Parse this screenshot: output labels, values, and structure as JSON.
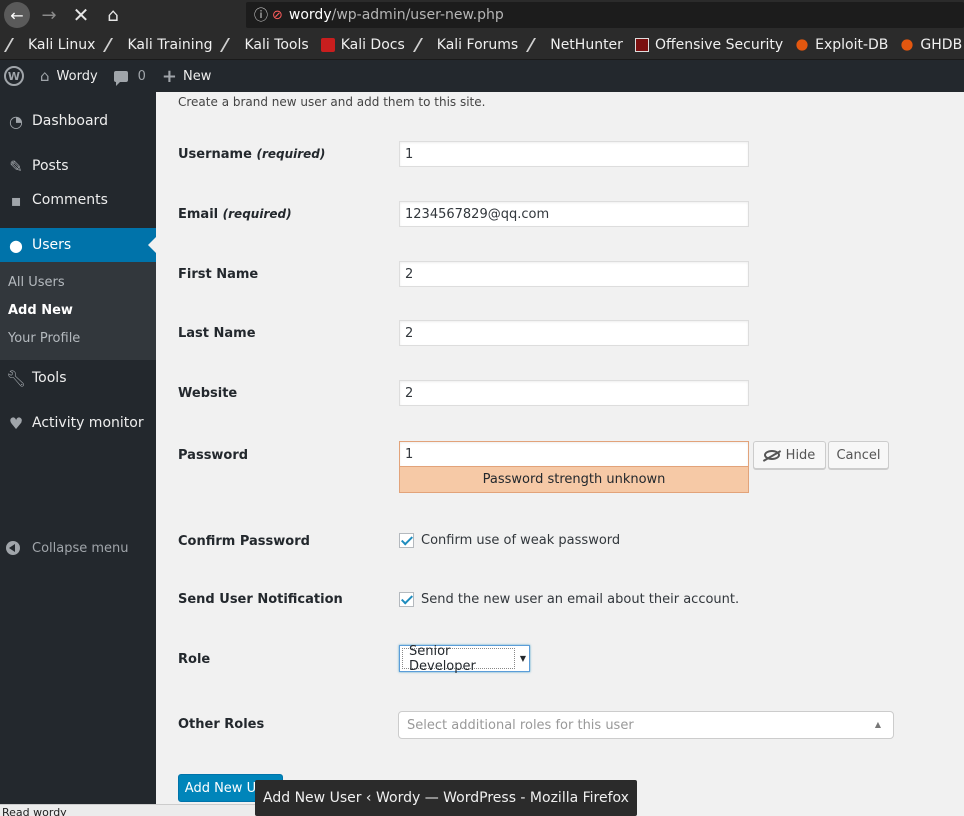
{
  "browser": {
    "url_host": "wordy",
    "url_path": "/wp-admin/user-new.php",
    "bookmarks": [
      "Kali Linux",
      "Kali Training",
      "Kali Tools",
      "Kali Docs",
      "Kali Forums",
      "NetHunter",
      "Offensive Security",
      "Exploit-DB",
      "GHDB"
    ],
    "status_text": "Read wordy",
    "tooltip": "Add New User ‹ Wordy — WordPress - Mozilla Firefox"
  },
  "adminbar": {
    "site_name": "Wordy",
    "comment_count": "0",
    "new_label": "New"
  },
  "menu": {
    "dashboard": "Dashboard",
    "posts": "Posts",
    "comments": "Comments",
    "users": "Users",
    "submenu": [
      "All Users",
      "Add New",
      "Your Profile"
    ],
    "tools": "Tools",
    "activity": "Activity monitor",
    "collapse": "Collapse menu"
  },
  "form": {
    "intro": "Create a brand new user and add them to this site.",
    "username_label": "Username",
    "required": "(required)",
    "username_value": "1",
    "email_label": "Email",
    "email_value": "1234567829@qq.com",
    "first_name_label": "First Name",
    "first_name_value": "2",
    "last_name_label": "Last Name",
    "last_name_value": "2",
    "website_label": "Website",
    "website_value": "2",
    "password_label": "Password",
    "password_value": "1",
    "password_strength": "Password strength unknown",
    "hide_label": "Hide",
    "cancel_label": "Cancel",
    "confirm_pw_label": "Confirm Password",
    "confirm_pw_text": "Confirm use of weak password",
    "notify_label": "Send User Notification",
    "notify_text": "Send the new user an email about their account.",
    "role_label": "Role",
    "role_value": "Senior Developer",
    "other_roles_label": "Other Roles",
    "other_roles_placeholder": "Select additional roles for this user",
    "submit_label": "Add New User"
  }
}
